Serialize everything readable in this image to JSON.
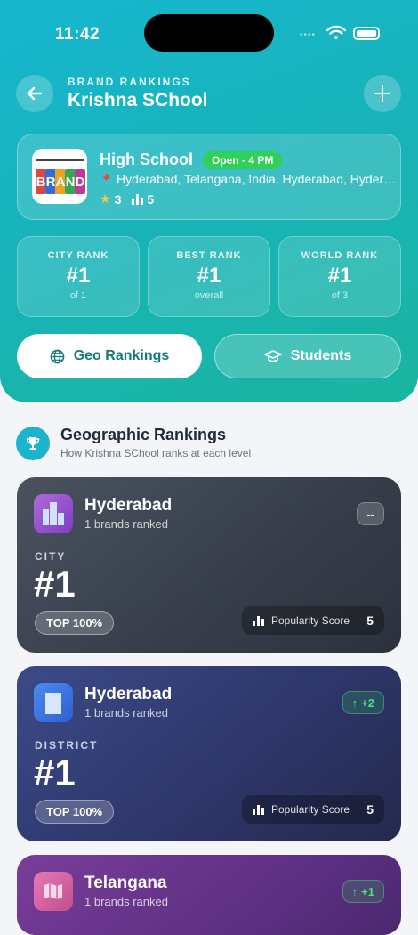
{
  "status": {
    "time": "11:42"
  },
  "header": {
    "eyebrow": "BRAND RANKINGS",
    "title": "Krishna SChool"
  },
  "school": {
    "logo_text": "BRAND",
    "name": "High School",
    "open_status": "Open - 4 PM",
    "location": "Hyderabad, Telangana, India, Hyderabad, Hyderabad",
    "rating": "3",
    "rankings_count": "5"
  },
  "rank_tiles": [
    {
      "label": "CITY RANK",
      "value": "#1",
      "sub": "of 1"
    },
    {
      "label": "BEST RANK",
      "value": "#1",
      "sub": "overall"
    },
    {
      "label": "WORLD RANK",
      "value": "#1",
      "sub": "of 3"
    }
  ],
  "tabs": {
    "geo": "Geo Rankings",
    "students": "Students"
  },
  "section": {
    "title": "Geographic Rankings",
    "subtitle": "How Krishna SChool ranks at each level"
  },
  "cards": [
    {
      "name": "Hyderabad",
      "count": "1 brands ranked",
      "change": "--",
      "level": "CITY",
      "rank": "#1",
      "top": "TOP 100%",
      "pop_label": "Popularity Score",
      "pop_value": "5"
    },
    {
      "name": "Hyderabad",
      "count": "1 brands ranked",
      "change": "+2",
      "change_arrow": "↑",
      "level": "DISTRICT",
      "rank": "#1",
      "top": "TOP 100%",
      "pop_label": "Popularity Score",
      "pop_value": "5"
    },
    {
      "name": "Telangana",
      "count": "1 brands ranked",
      "change": "+1",
      "change_arrow": "↑"
    }
  ],
  "colors": {
    "accent": "#16b6cf",
    "success": "#30d158",
    "city_card": "#363d4a",
    "district_card": "#2d3568",
    "state_card": "#5a2e80"
  }
}
